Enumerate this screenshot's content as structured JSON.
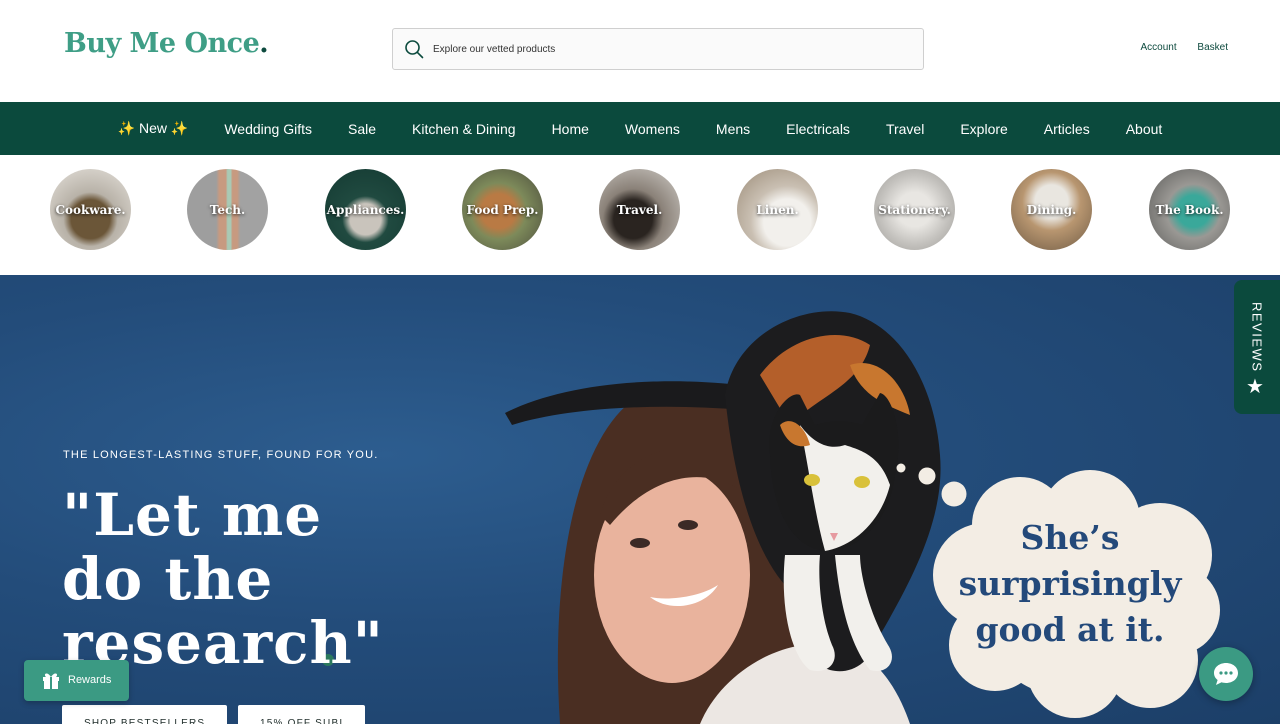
{
  "brand": {
    "name": "Buy Me Once",
    "dot": "."
  },
  "search": {
    "placeholder": "Explore our vetted products"
  },
  "header_links": {
    "account": "Account",
    "basket": "Basket"
  },
  "nav": [
    {
      "label": "✨ New ✨"
    },
    {
      "label": "Wedding Gifts"
    },
    {
      "label": "Sale"
    },
    {
      "label": "Kitchen & Dining"
    },
    {
      "label": "Home"
    },
    {
      "label": "Womens"
    },
    {
      "label": "Mens"
    },
    {
      "label": "Electricals"
    },
    {
      "label": "Travel"
    },
    {
      "label": "Explore"
    },
    {
      "label": "Articles"
    },
    {
      "label": "About"
    }
  ],
  "categories": [
    {
      "label": "Cookware."
    },
    {
      "label": "Tech."
    },
    {
      "label": "Appliances."
    },
    {
      "label": "Food Prep."
    },
    {
      "label": "Travel."
    },
    {
      "label": "Linen."
    },
    {
      "label": "Stationery."
    },
    {
      "label": "Dining."
    },
    {
      "label": "The Book."
    }
  ],
  "hero": {
    "tagline": "THE LONGEST-LASTING STUFF, FOUND FOR YOU.",
    "headline": "\"Let me do the research\"",
    "thought_bubble": "She’s surprisingly good at it.",
    "cta_primary": "SHOP BESTSELLERS",
    "cta_secondary": "15% OFF SUBI"
  },
  "widgets": {
    "reviews": "REVIEWS",
    "rewards": "Rewards"
  },
  "colors": {
    "brand_green": "#0b4a3d",
    "accent_teal": "#3b9a83",
    "hero_blue": "#234c7a"
  }
}
